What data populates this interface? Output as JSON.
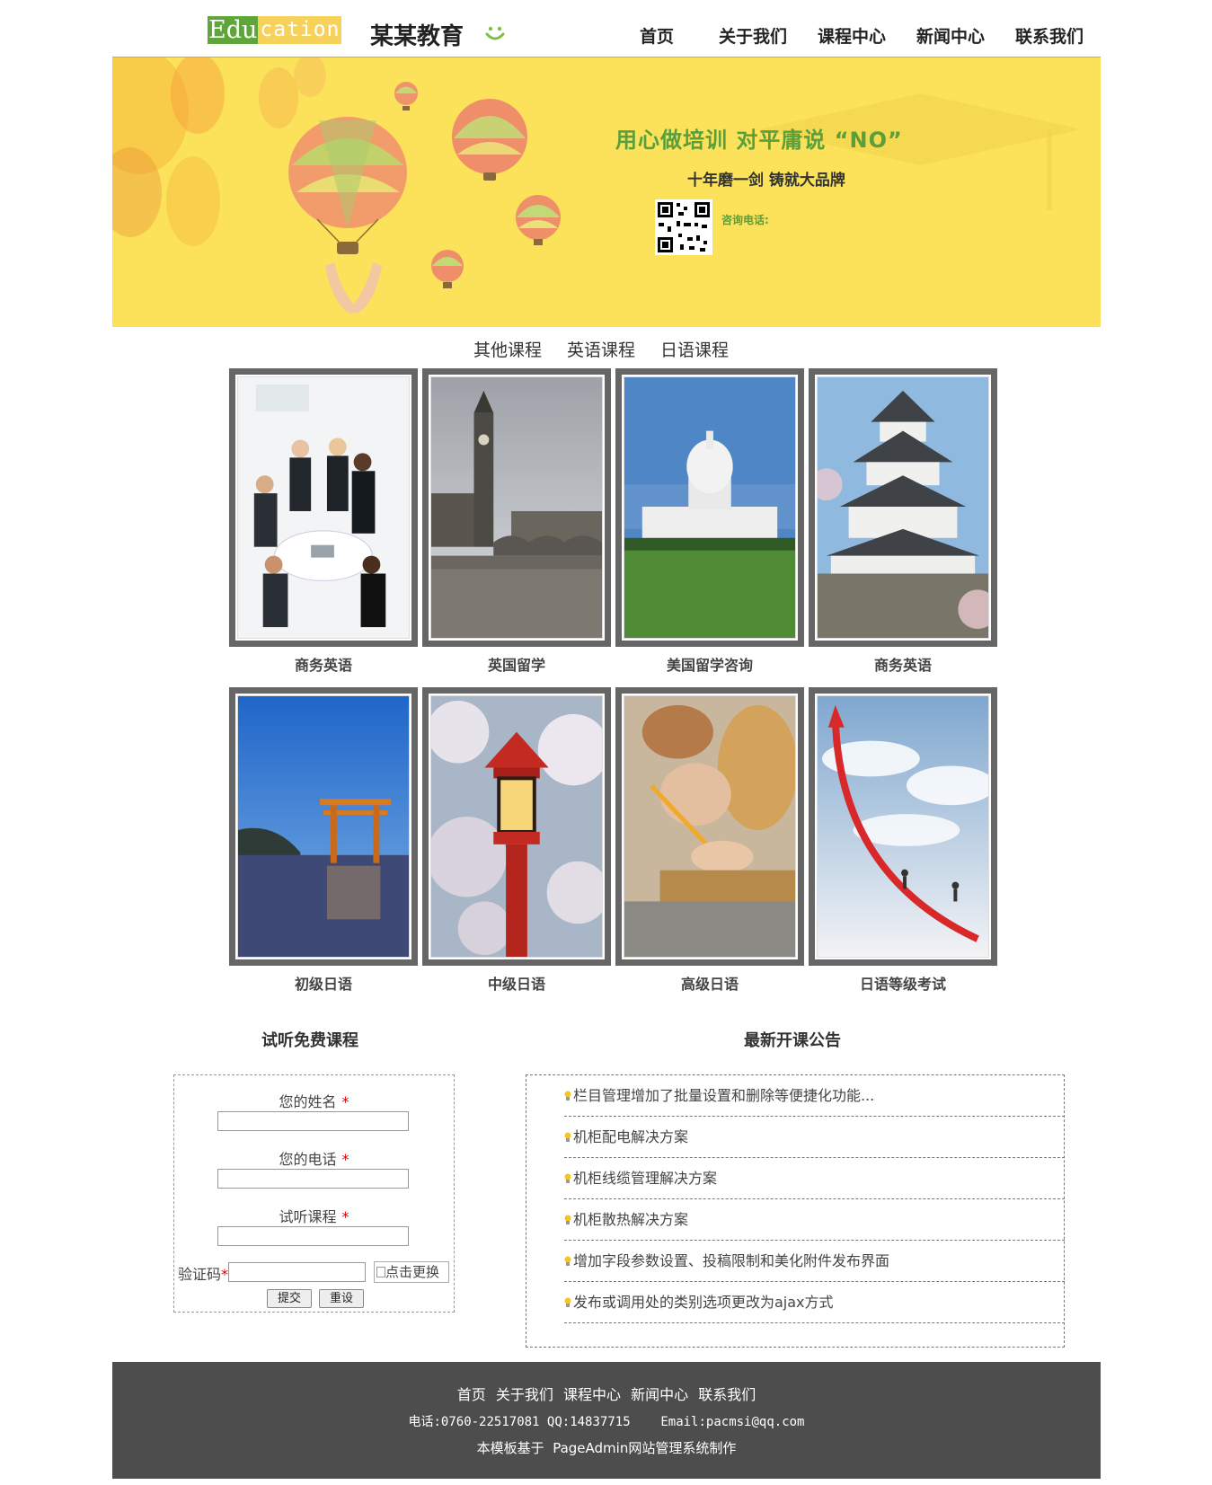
{
  "header": {
    "logo_part1": "Edu",
    "logo_part2": "cation",
    "site_name": "某某教育",
    "nav": [
      "首页",
      "关于我们",
      "课程中心",
      "新闻中心",
      "联系我们"
    ]
  },
  "banner": {
    "headline": "用心做培训 对平庸说 “NO”",
    "subline": "十年磨一剑 铸就大品牌",
    "consult_label": "咨询电话:"
  },
  "tabs": [
    "其他课程",
    "英语课程",
    "日语课程"
  ],
  "courses": [
    {
      "name": "商务英语",
      "image": "business-meeting"
    },
    {
      "name": "英国留学",
      "image": "big-ben"
    },
    {
      "name": "美国留学咨询",
      "image": "us-capitol"
    },
    {
      "name": "商务英语",
      "image": "japanese-castle"
    },
    {
      "name": "初级日语",
      "image": "torii-gate"
    },
    {
      "name": "中级日语",
      "image": "lantern-cherry-blossom"
    },
    {
      "name": "高级日语",
      "image": "student-writing"
    },
    {
      "name": "日语等级考试",
      "image": "red-arrow-climb"
    }
  ],
  "trial": {
    "title": "试听免费课程",
    "name_label": "您的姓名",
    "phone_label": "您的电话",
    "course_label": "试听课程",
    "required_mark": "*",
    "captcha_label": "验证码",
    "captcha_alt": "点击更换",
    "submit_label": "提交",
    "reset_label": "重设"
  },
  "news": {
    "title": "最新开课公告",
    "items": [
      "栏目管理增加了批量设置和删除等便捷化功能...",
      "机柜配电解决方案",
      "机柜线缆管理解决方案",
      "机柜散热解决方案",
      "增加字段参数设置、投稿限制和美化附件发布界面",
      "发布或调用处的类别选项更改为ajax方式"
    ]
  },
  "footer": {
    "links": [
      "首页",
      "关于我们",
      "课程中心",
      "新闻中心",
      "联系我们"
    ],
    "contact": "电话:0760-22517081 QQ:14837715    Email:pacmsi@qq.com",
    "powered": "本模板基于  PageAdmin网站管理系统制作"
  },
  "colors": {
    "banner_bg": "#fbe25a",
    "accent_green": "#5b9e3c",
    "footer_bg": "#4d4d4d",
    "frame": "#666666"
  }
}
